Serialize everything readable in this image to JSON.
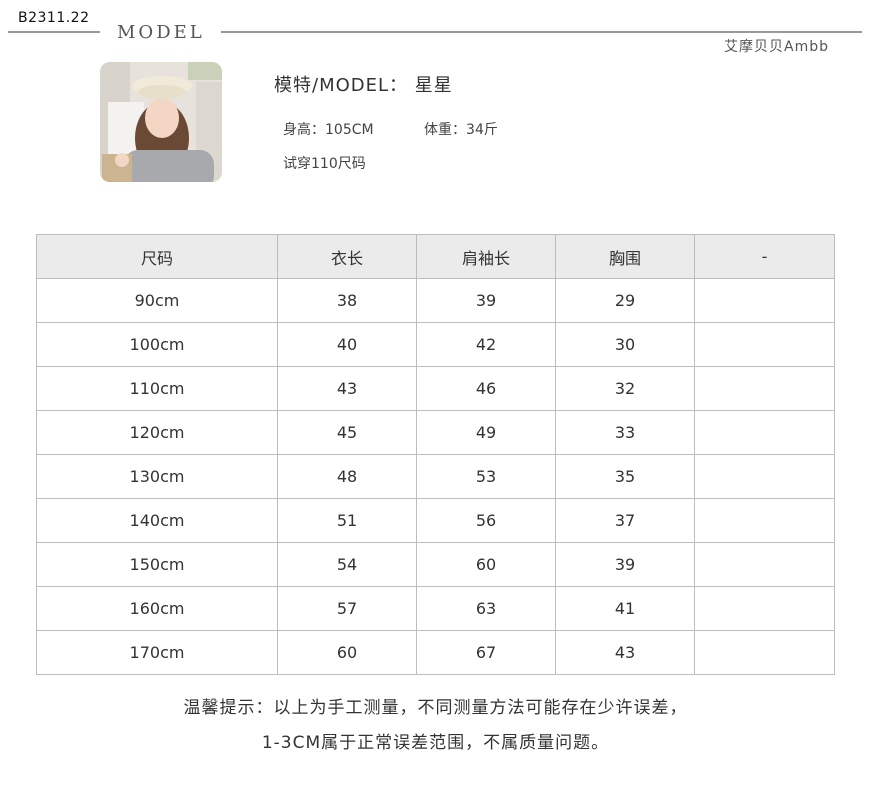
{
  "code": "B2311.22",
  "header": {
    "title": "MODEL",
    "brand": "艾摩贝贝Ambb"
  },
  "model": {
    "name_line": "模特/MODEL：  星星",
    "height": "身高：105CM",
    "weight": "体重：34斤",
    "trial": "试穿110尺码"
  },
  "table": {
    "headers": [
      "尺码",
      "衣长",
      "肩袖长",
      "胸围",
      "-"
    ],
    "rows": [
      [
        "90cm",
        "38",
        "39",
        "29",
        ""
      ],
      [
        "100cm",
        "40",
        "42",
        "30",
        ""
      ],
      [
        "110cm",
        "43",
        "46",
        "32",
        ""
      ],
      [
        "120cm",
        "45",
        "49",
        "33",
        ""
      ],
      [
        "130cm",
        "48",
        "53",
        "35",
        ""
      ],
      [
        "140cm",
        "51",
        "56",
        "37",
        ""
      ],
      [
        "150cm",
        "54",
        "60",
        "39",
        ""
      ],
      [
        "160cm",
        "57",
        "63",
        "41",
        ""
      ],
      [
        "170cm",
        "60",
        "67",
        "43",
        ""
      ]
    ]
  },
  "notes": {
    "line1": "温馨提示：以上为手工测量，不同测量方法可能存在少许误差，",
    "line2": "1-3CM属于正常误差范围，不属质量问题。"
  }
}
